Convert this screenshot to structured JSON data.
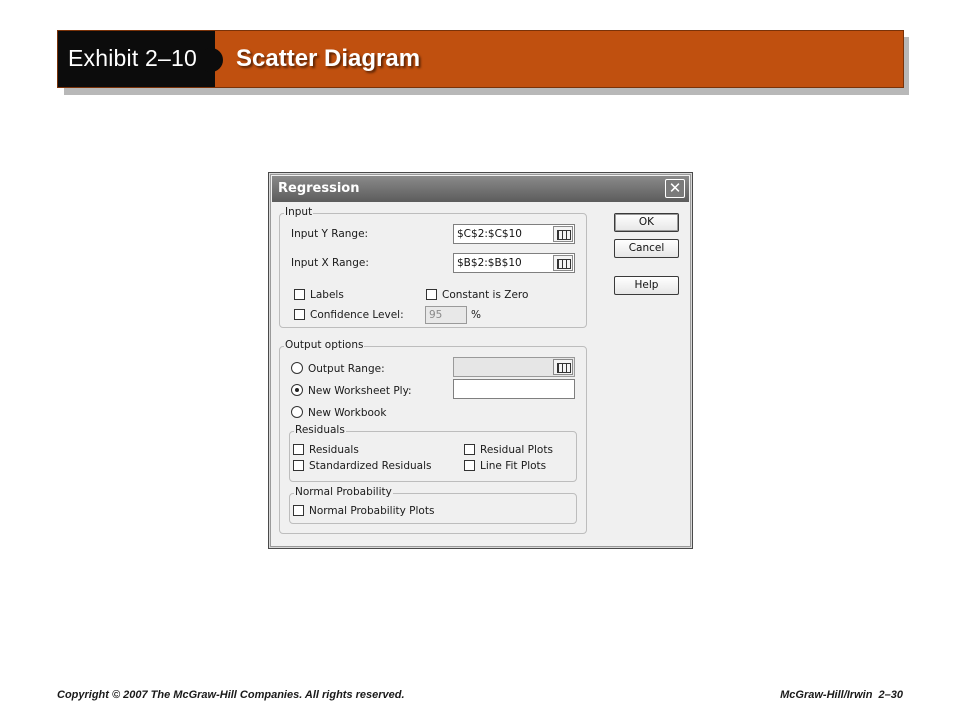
{
  "header": {
    "exhibit": "Exhibit 2–10",
    "title": "Scatter Diagram"
  },
  "dialog": {
    "title": "Regression",
    "close_glyph": "✕",
    "input_group": {
      "label": "Input",
      "y_range_label": "Input Y Range:",
      "y_range_value": "$C$2:$C$10",
      "x_range_label": "Input X Range:",
      "x_range_value": "$B$2:$B$10",
      "labels_label": "Labels",
      "labels_checked": false,
      "constant_zero_label": "Constant is Zero",
      "constant_zero_checked": false,
      "confidence_label": "Confidence Level:",
      "confidence_checked": false,
      "confidence_value": "95",
      "percent": "%"
    },
    "output_group": {
      "label": "Output options",
      "output_range_label": "Output Range:",
      "output_range_selected": false,
      "new_worksheet_label": "New Worksheet Ply:",
      "new_worksheet_selected": true,
      "new_workbook_label": "New Workbook",
      "new_workbook_selected": false
    },
    "residuals_group": {
      "label": "Residuals",
      "residuals_label": "Residuals",
      "standardized_label": "Standardized Residuals",
      "residual_plots_label": "Residual Plots",
      "line_fit_label": "Line Fit Plots"
    },
    "normal_group": {
      "label": "Normal Probability",
      "plots_label": "Normal Probability Plots"
    },
    "buttons": {
      "ok": "OK",
      "cancel": "Cancel",
      "help": "Help"
    }
  },
  "footer": {
    "copyright": "Copyright © 2007 The McGraw-Hill Companies. All rights reserved.",
    "page": "McGraw-Hill/Irwin  2–30"
  },
  "colors": {
    "header_orange": "#c0500f",
    "header_black": "#0c0c0c",
    "dialog_titlebar": "#6e6e6e"
  }
}
